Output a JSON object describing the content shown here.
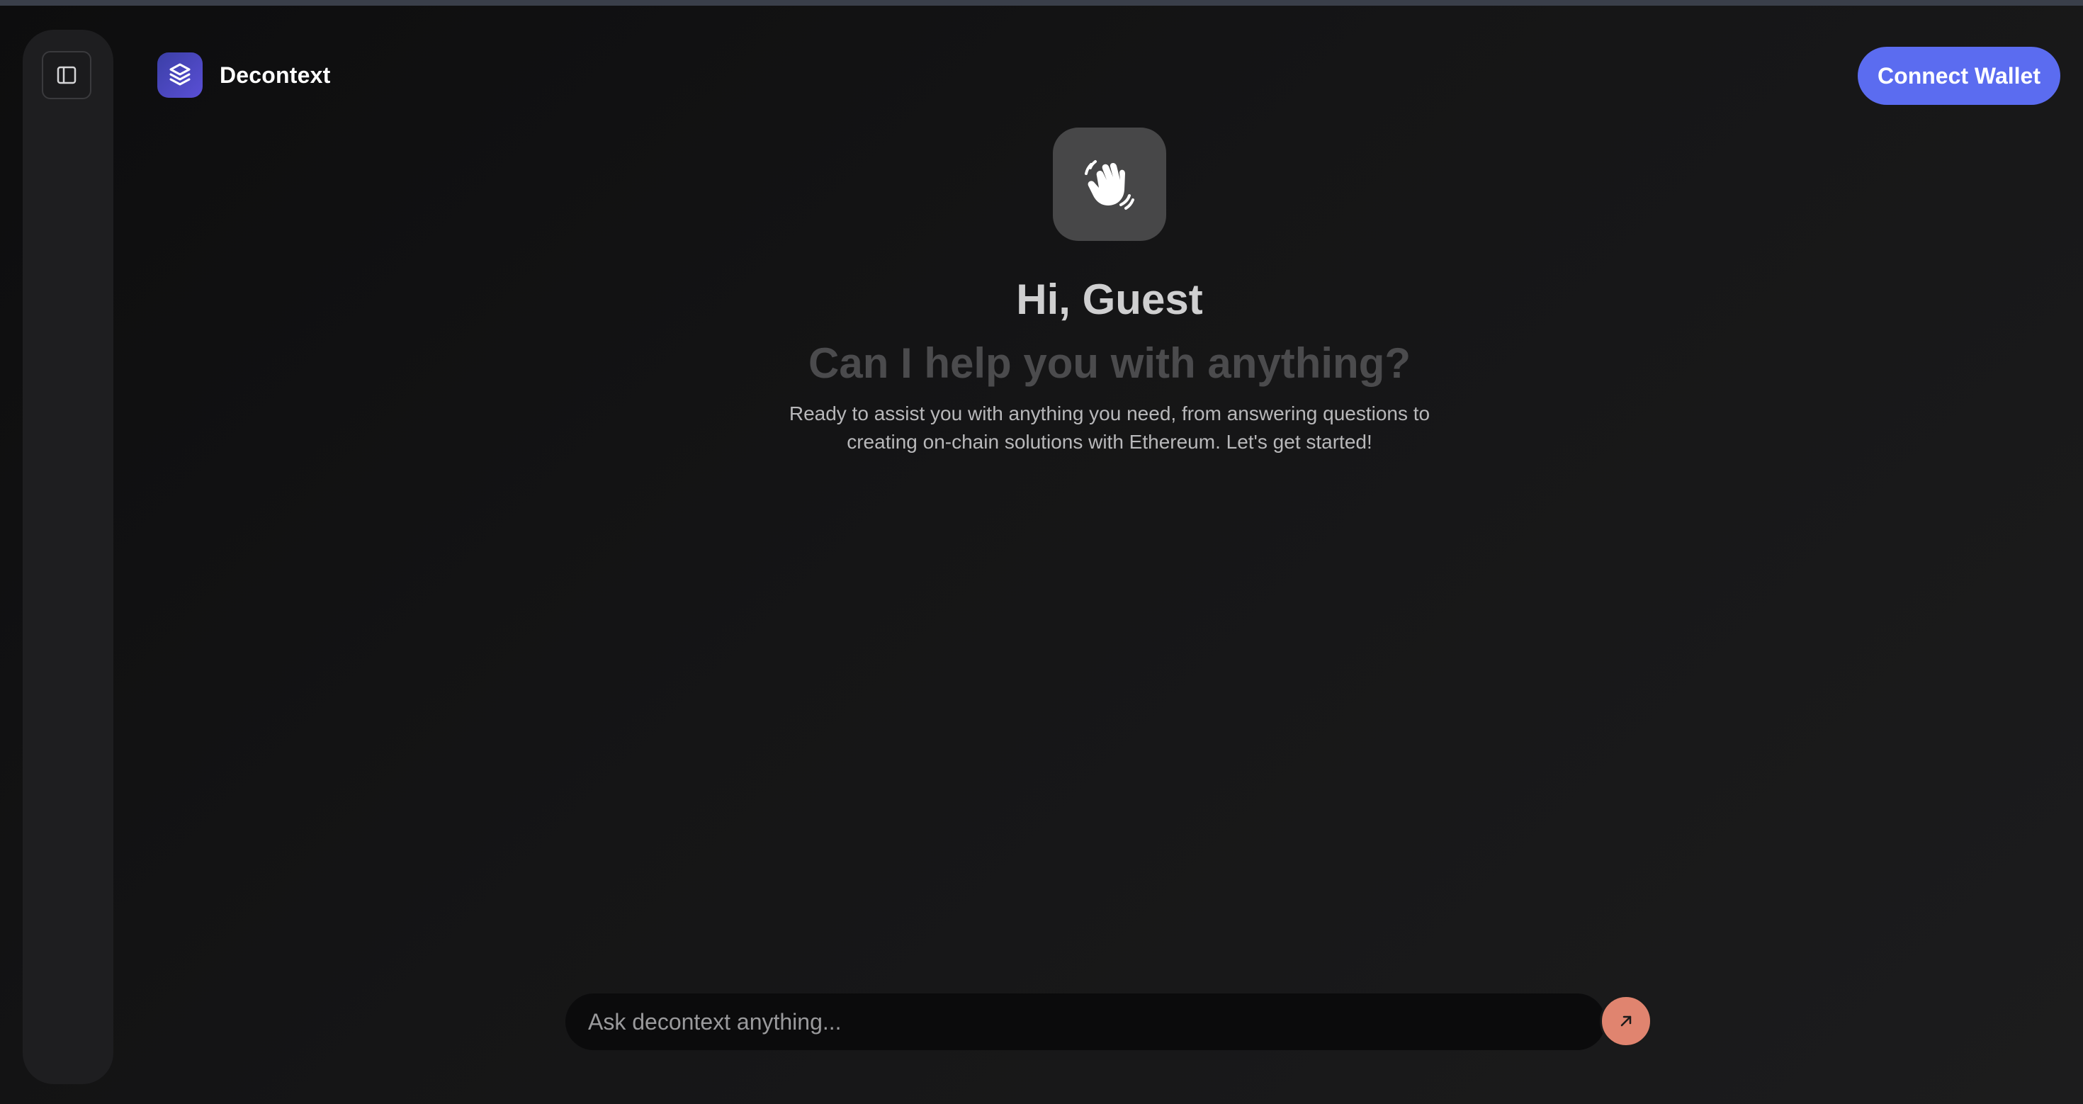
{
  "app": {
    "brand_name": "Decontext",
    "accent_color": "#5b6cf0"
  },
  "sidebar": {
    "toggle_icon": "sidebar-panel-icon"
  },
  "header": {
    "connect_wallet_label": "Connect Wallet"
  },
  "hero": {
    "icon": "waving-hand-icon",
    "greeting": "Hi, Guest",
    "subheading": "Can I help you with anything?",
    "description": "Ready to assist you with anything you need, from answering questions to creating on-chain solutions with Ethereum. Let's get started!"
  },
  "chat": {
    "placeholder": "Ask decontext anything...",
    "send_icon": "arrow-up-right-icon",
    "send_color": "#e0846f"
  }
}
